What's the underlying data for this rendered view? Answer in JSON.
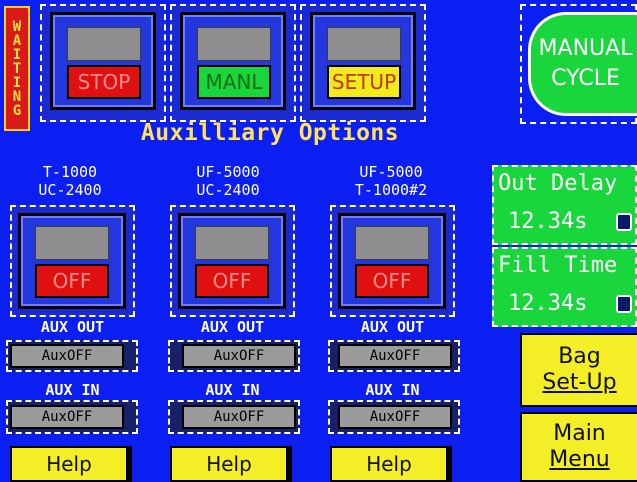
{
  "status": {
    "waiting": "WAITING"
  },
  "top_buttons": [
    {
      "label": "STOP",
      "color": "#e01010"
    },
    {
      "label": "MANL",
      "color": "#19d63c"
    },
    {
      "label": "SETUP",
      "color": "#f2ea1a"
    }
  ],
  "manual_cycle": {
    "line1": "MANUAL",
    "line2": "CYCLE"
  },
  "section_title": "Auxilliary Options",
  "columns": [
    {
      "line1": "T-1000",
      "line2": "UC-2400",
      "state": "OFF",
      "aux_out_label": "AUX OUT",
      "aux_out_value": "AuxOFF",
      "aux_in_label": "AUX IN",
      "aux_in_value": "AuxOFF",
      "help": "Help"
    },
    {
      "line1": "UF-5000",
      "line2": "UC-2400",
      "state": "OFF",
      "aux_out_label": "AUX OUT",
      "aux_out_value": "AuxOFF",
      "aux_in_label": "AUX IN",
      "aux_in_value": "AuxOFF",
      "help": "Help"
    },
    {
      "line1": "UF-5000",
      "line2": "T-1000#2",
      "state": "OFF",
      "aux_out_label": "AUX OUT",
      "aux_out_value": "AuxOFF",
      "aux_in_label": "AUX IN",
      "aux_in_value": "AuxOFF",
      "help": "Help"
    }
  ],
  "out_delay": {
    "label": "Out Delay",
    "value": "12.34s"
  },
  "fill_time": {
    "label": "Fill Time",
    "value": "12.34s"
  },
  "bag_setup": {
    "line1": "Bag",
    "line2": "Set-Up"
  },
  "main_menu": {
    "line1": "Main",
    "line2": "Menu"
  }
}
